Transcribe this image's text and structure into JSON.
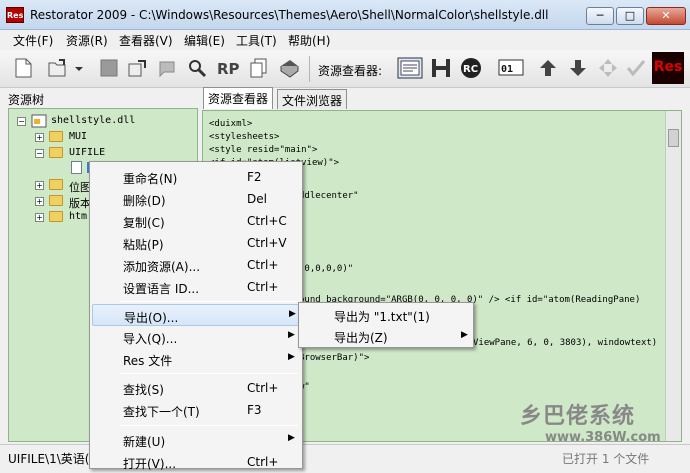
{
  "window": {
    "title": "Restorator 2009 - C:\\Windows\\Resources\\Themes\\Aero\\Shell\\NormalColor\\shellstyle.dll",
    "app_icon_text": "Res",
    "min": "─",
    "max": "□",
    "close": "✕"
  },
  "menubar": [
    "文件(F)",
    "资源(R)",
    "查看器(V)",
    "编辑(E)",
    "工具(T)",
    "帮助(H)"
  ],
  "toolbar": {
    "viewer_label": "资源查看器:",
    "res_logo_text": "Res"
  },
  "left_panel": {
    "header": "资源树",
    "tree": [
      {
        "label": "shellstyle.dll",
        "expander": "−"
      },
      {
        "label": "MUI",
        "expander": "+"
      },
      {
        "label": "UIFILE",
        "expander": "−"
      },
      {
        "label": "1",
        "expander": ""
      },
      {
        "label": "位图",
        "expander": "+"
      },
      {
        "label": "版本",
        "expander": "+"
      },
      {
        "label": "htm",
        "expander": "+"
      }
    ]
  },
  "tabs": [
    "资源查看器",
    "文件浏览器"
  ],
  "editor": {
    "lines": [
      "<duixml>",
      "<stylesheets>",
      "<style resid=\"main\">",
      "<if id=\"atom(listview)\">",
      "ddlecenter\"",
      "(0,0,0,0)\"",
      "ound background=\"ARGB(0, 0, 0, 0)\" /> <if id=\"atom(ReadingPane)",
      "ViewPane, 6, 0, 3803), windowtext)",
      "BrowserBar)\">",
      "w\""
    ]
  },
  "context_menu": {
    "items": [
      {
        "label": "重命名(N)",
        "shortcut": "F2",
        "arrow": ""
      },
      {
        "label": "删除(D)",
        "shortcut": "Del",
        "arrow": ""
      },
      {
        "label": "复制(C)",
        "shortcut": "Ctrl+C",
        "arrow": ""
      },
      {
        "label": "粘贴(P)",
        "shortcut": "Ctrl+V",
        "arrow": ""
      },
      {
        "label": "添加资源(A)...",
        "shortcut": "Ctrl+",
        "arrow": ""
      },
      {
        "label": "设置语言 ID...",
        "shortcut": "Ctrl+",
        "arrow": ""
      },
      {
        "label": "导出(O)...",
        "shortcut": "",
        "arrow": "▶"
      },
      {
        "label": "导入(Q)...",
        "shortcut": "",
        "arrow": "▶"
      },
      {
        "label": "Res 文件",
        "shortcut": "",
        "arrow": "▶"
      },
      {
        "label": "查找(S)",
        "shortcut": "Ctrl+",
        "arrow": ""
      },
      {
        "label": "查找下一个(T)",
        "shortcut": "F3",
        "arrow": ""
      },
      {
        "label": "新建(U)",
        "shortcut": "",
        "arrow": "▶"
      },
      {
        "label": "打开(V)...",
        "shortcut": "Ctrl+",
        "arrow": ""
      }
    ]
  },
  "sub_menu": {
    "items": [
      "导出为 \"1.txt\"(1)",
      "导出为(Z)"
    ],
    "arrow": "▶"
  },
  "statusbar": {
    "left": "UIFILE\\1\\英语(",
    "right": "已打开 1 个文件"
  },
  "watermark": {
    "line1": "乡巴佬系统",
    "line2": "www.386W.com"
  }
}
